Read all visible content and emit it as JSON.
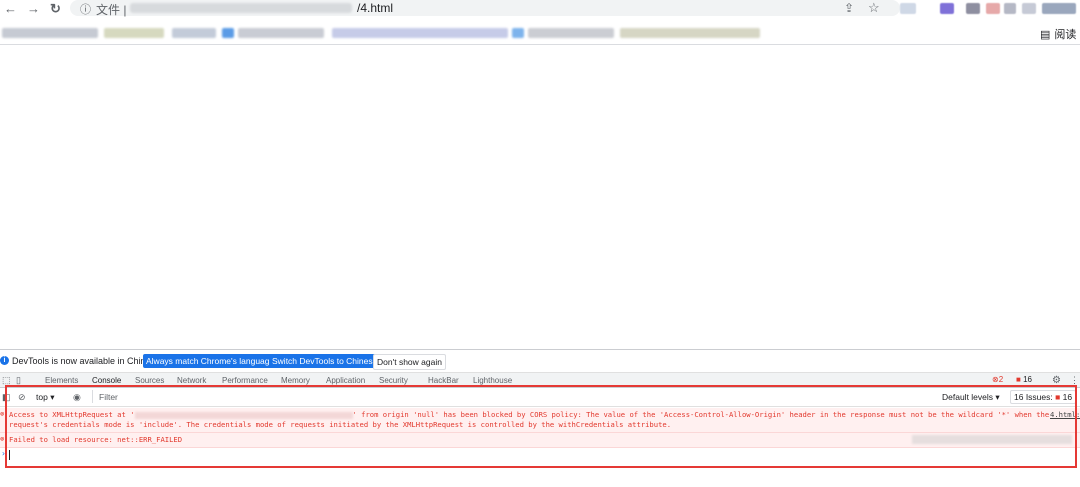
{
  "browser": {
    "omnibox": {
      "info_icon": "info-icon",
      "label": "文件",
      "separator": "|",
      "url_suffix": "/4.html"
    },
    "reader_mode_label": "阅读",
    "icons": [
      "back-arrow-icon",
      "forward-arrow-icon",
      "reload-icon",
      "share-icon",
      "star-icon",
      "reader-mode-icon"
    ]
  },
  "devtools": {
    "infobar": {
      "text": "DevTools is now available in Chinese!",
      "match_language_label": "Always match Chrome's language",
      "switch_language_label": "Switch DevTools to Chinese",
      "dismiss_label": "Don't show again"
    },
    "tabs": [
      {
        "label": "Elements"
      },
      {
        "label": "Console"
      },
      {
        "label": "Sources"
      },
      {
        "label": "Network"
      },
      {
        "label": "Performance"
      },
      {
        "label": "Memory"
      },
      {
        "label": "Application"
      },
      {
        "label": "Security"
      },
      {
        "label": "HackBar"
      },
      {
        "label": "Lighthouse"
      }
    ],
    "active_tab": "Console",
    "error_count": "2",
    "issue_count_badge": "16",
    "console_toolbar": {
      "context": "top",
      "filter_placeholder": "Filter",
      "levels_label": "Default levels",
      "issues_label": "16 Issues:",
      "issues_count": "16"
    },
    "messages": [
      {
        "line1_prefix": "Access to XMLHttpRequest at '",
        "line1_suffix": "' from origin 'null' has been blocked by CORS policy: The value of the 'Access-Control-Allow-Origin' header in the response must not be the wildcard '*' when the",
        "line2": "request's credentials mode is 'include'. The credentials mode of requests initiated by the XMLHttpRequest is controlled by the withCredentials attribute.",
        "source": "4.html:"
      },
      {
        "line1": "Failed to load resource: net::ERR_FAILED"
      }
    ],
    "colors": {
      "error_text": "#e2382d",
      "error_bg": "#fff0f0",
      "accent_blue": "#1a73e8",
      "annotation_red": "#e53935"
    }
  }
}
